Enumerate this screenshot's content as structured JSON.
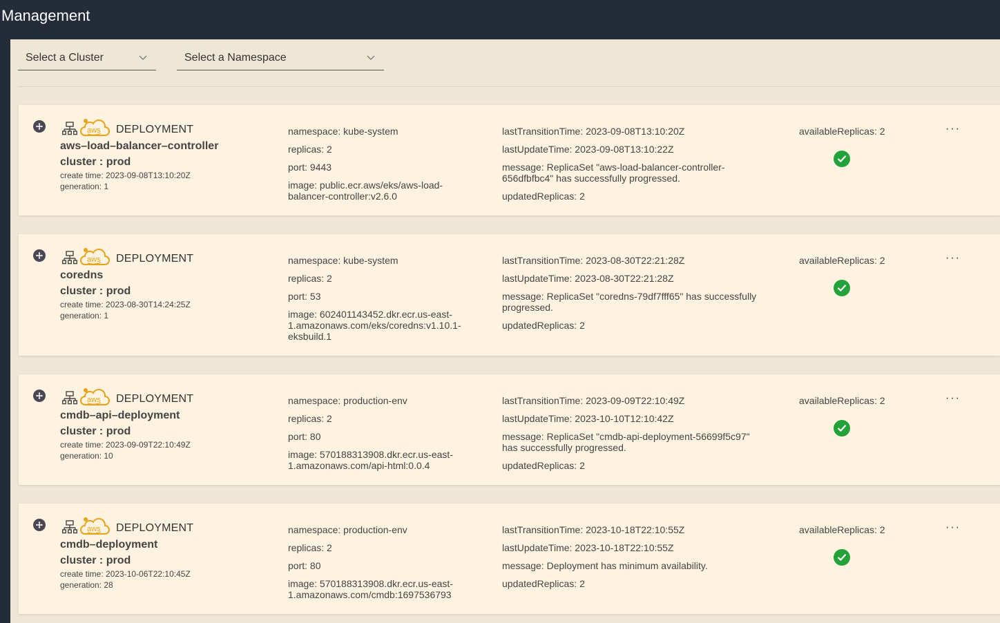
{
  "header": {
    "title": "Management"
  },
  "filters": {
    "cluster_label": "Select a Cluster",
    "namespace_label": "Select a Namespace"
  },
  "colors": {
    "topbar": "#232c38",
    "background": "#efe7d6",
    "card": "#fdf3e0",
    "success": "#23a23a",
    "aws": "#e8a317"
  },
  "deployments": [
    {
      "kind": "DEPLOYMENT",
      "name": "aws–load–balancer–controller",
      "cluster": "cluster : prod",
      "create_time": "create time: 2023-09-08T13:10:20Z",
      "generation": "generation: 1",
      "namespace": "namespace: kube-system",
      "replicas": "replicas: 2",
      "port": "port: 9443",
      "image": "image: public.ecr.aws/eks/aws-load-balancer-controller:v2.6.0",
      "last_transition": "lastTransitionTime: 2023-09-08T13:10:20Z",
      "last_update": "lastUpdateTime: 2023-09-08T13:10:22Z",
      "message": "message: ReplicaSet \"aws-load-balancer-controller-656dfbfbc4\" has successfully progressed.",
      "updated_replicas": "updatedReplicas: 2",
      "available_replicas": "availableReplicas: 2",
      "more": "···"
    },
    {
      "kind": "DEPLOYMENT",
      "name": "coredns",
      "cluster": "cluster : prod",
      "create_time": "create time: 2023-08-30T14:24:25Z",
      "generation": "generation: 1",
      "namespace": "namespace: kube-system",
      "replicas": "replicas: 2",
      "port": "port: 53",
      "image": "image: 602401143452.dkr.ecr.us-east-1.amazonaws.com/eks/coredns:v1.10.1-eksbuild.1",
      "last_transition": "lastTransitionTime: 2023-08-30T22:21:28Z",
      "last_update": "lastUpdateTime: 2023-08-30T22:21:28Z",
      "message": "message: ReplicaSet \"coredns-79df7fff65\" has successfully progressed.",
      "updated_replicas": "updatedReplicas: 2",
      "available_replicas": "availableReplicas: 2",
      "more": "···"
    },
    {
      "kind": "DEPLOYMENT",
      "name": "cmdb–api–deployment",
      "cluster": "cluster : prod",
      "create_time": "create time: 2023-09-09T22:10:49Z",
      "generation": "generation: 10",
      "namespace": "namespace: production-env",
      "replicas": "replicas: 2",
      "port": "port: 80",
      "image": "image: 570188313908.dkr.ecr.us-east-1.amazonaws.com/api-html:0.0.4",
      "last_transition": "lastTransitionTime: 2023-09-09T22:10:49Z",
      "last_update": "lastUpdateTime: 2023-10-10T12:10:42Z",
      "message": "message: ReplicaSet \"cmdb-api-deployment-56699f5c97\" has successfully progressed.",
      "updated_replicas": "updatedReplicas: 2",
      "available_replicas": "availableReplicas: 2",
      "more": "···"
    },
    {
      "kind": "DEPLOYMENT",
      "name": "cmdb–deployment",
      "cluster": "cluster : prod",
      "create_time": "create time: 2023-10-06T22:10:45Z",
      "generation": "generation: 28",
      "namespace": "namespace: production-env",
      "replicas": "replicas: 2",
      "port": "port: 80",
      "image": "image: 570188313908.dkr.ecr.us-east-1.amazonaws.com/cmdb:1697536793",
      "last_transition": "lastTransitionTime: 2023-10-18T22:10:55Z",
      "last_update": "lastUpdateTime: 2023-10-18T22:10:55Z",
      "message": "message: Deployment has minimum availability.",
      "updated_replicas": "updatedReplicas: 2",
      "available_replicas": "availableReplicas: 2",
      "more": "···"
    }
  ]
}
